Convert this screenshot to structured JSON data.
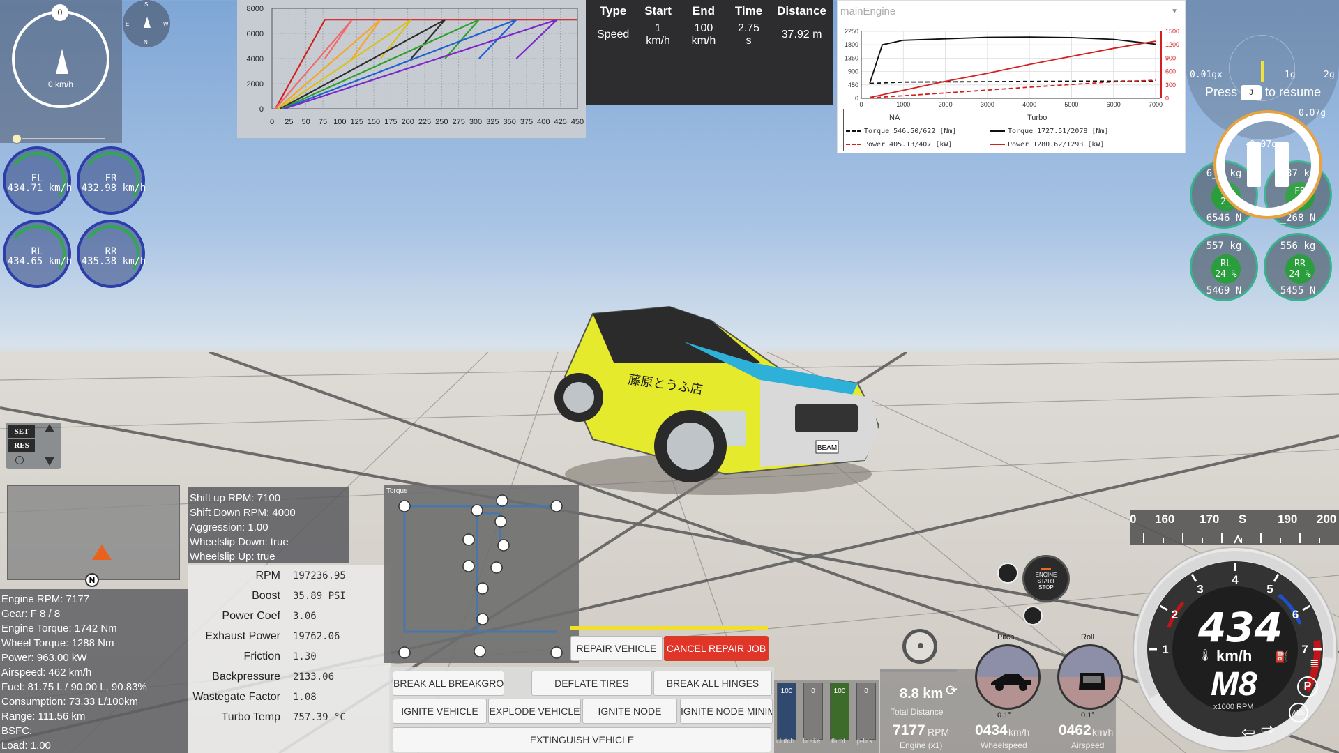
{
  "colors": {
    "accent_red": "#e1352a",
    "yellow": "#f0e02a",
    "green": "#2a9d3c",
    "blue_ring": "#2c3ea8"
  },
  "speedometer": {
    "top_value": "0",
    "speed_text": "0 km/h"
  },
  "compass_mini": {
    "n": "N",
    "s": "S",
    "e": "E",
    "w": "W"
  },
  "wheel_speeds": [
    {
      "label": "FL",
      "value": "434.71 km/h"
    },
    {
      "label": "FR",
      "value": "432.98 km/h"
    },
    {
      "label": "RL",
      "value": "434.65 km/h"
    },
    {
      "label": "RR",
      "value": "435.38 km/h"
    }
  ],
  "chart_data": [
    {
      "type": "line",
      "title": "",
      "xlabel": "",
      "ylabel": "",
      "xlim": [
        0,
        450
      ],
      "ylim": [
        0,
        8000
      ],
      "x_ticks": [
        "0",
        "25",
        "50",
        "75",
        "100",
        "125",
        "150",
        "175",
        "200",
        "225",
        "250",
        "275",
        "300",
        "325",
        "350",
        "375",
        "400",
        "425",
        "450"
      ],
      "y_ticks": [
        "0",
        "2000",
        "4000",
        "6000",
        "8000"
      ],
      "series": [
        {
          "color": "#d41f1f",
          "x": [
            5,
            78,
            78,
            450
          ],
          "y": [
            0,
            7100,
            7100,
            7100
          ]
        },
        {
          "color": "#f06a6a",
          "x": [
            5,
            118,
            78,
            118
          ],
          "y": [
            0,
            7100,
            4000,
            7100
          ]
        },
        {
          "color": "#f5a623",
          "x": [
            8,
            160,
            118,
            160
          ],
          "y": [
            0,
            7100,
            4000,
            7100
          ]
        },
        {
          "color": "#d8c21c",
          "x": [
            10,
            205,
            160,
            205
          ],
          "y": [
            0,
            7100,
            4000,
            7100
          ]
        },
        {
          "color": "#2e2e2e",
          "x": [
            12,
            255,
            205,
            255
          ],
          "y": [
            0,
            7100,
            4000,
            7100
          ]
        },
        {
          "color": "#2ca02c",
          "x": [
            14,
            305,
            255,
            305
          ],
          "y": [
            0,
            7100,
            4000,
            7100
          ]
        },
        {
          "color": "#1f5fd4",
          "x": [
            16,
            360,
            305,
            360
          ],
          "y": [
            0,
            7100,
            4000,
            7100
          ]
        },
        {
          "color": "#7a28c9",
          "x": [
            18,
            420,
            360,
            420
          ],
          "y": [
            0,
            7100,
            4000,
            7100
          ]
        }
      ]
    },
    {
      "type": "line",
      "title": "mainEngine",
      "xlabel": "",
      "ylabel": "",
      "xlim": [
        0,
        7100
      ],
      "ylim_left": [
        0,
        2250
      ],
      "ylim_right": [
        0,
        1500
      ],
      "x_ticks": [
        "0",
        "1000",
        "2000",
        "3000",
        "4000",
        "5000",
        "6000",
        "7000"
      ],
      "y_ticks_left": [
        "0",
        "450",
        "900",
        "1350",
        "1800",
        "2250"
      ],
      "y_ticks_right": [
        "0",
        "300",
        "600",
        "900",
        "1200",
        "1500"
      ],
      "series": [
        {
          "name": "NA Torque",
          "style": "dashed",
          "color": "#111111",
          "x": [
            200,
            1000,
            3000,
            5000,
            7000
          ],
          "y": [
            500,
            546,
            560,
            575,
            580
          ]
        },
        {
          "name": "NA Power",
          "style": "dashed",
          "color": "#d41f1f",
          "x": [
            200,
            2000,
            4000,
            6000,
            7000
          ],
          "y": [
            10,
            120,
            250,
            370,
            405
          ]
        },
        {
          "name": "Turbo Torque",
          "style": "solid",
          "color": "#111111",
          "x": [
            200,
            500,
            1000,
            2000,
            3000,
            4000,
            5000,
            6000,
            7000
          ],
          "y": [
            500,
            1800,
            1950,
            2000,
            2050,
            2060,
            2040,
            1980,
            1820
          ]
        },
        {
          "name": "Turbo Power",
          "style": "solid",
          "color": "#d41f1f",
          "x": [
            200,
            1000,
            2000,
            3000,
            4000,
            5000,
            6000,
            7000
          ],
          "y": [
            20,
            180,
            380,
            560,
            760,
            940,
            1120,
            1280
          ]
        }
      ]
    }
  ],
  "engine_chart": {
    "dropdown": "mainEngine",
    "na_header": "NA",
    "turbo_header": "Turbo",
    "na_torque": "Torque 546.50/622 [Nm]",
    "na_power": "Power 405.13/407 [kW]",
    "turbo_torque": "Torque 1727.51/2078 [Nm]",
    "turbo_power": "Power 1280.62/1293 [kW]"
  },
  "timing_table": {
    "headers": [
      "Type",
      "Start",
      "End",
      "Time",
      "Distance"
    ],
    "row": [
      "Speed",
      "1 km/h",
      "100 km/h",
      "2.75 s",
      "37.92 m"
    ]
  },
  "gforce": {
    "left": "0.01gx",
    "g1": "1g",
    "g2": "2g",
    "right": "0.07g",
    "lower": "-0.07gy"
  },
  "resume": {
    "press": "Press",
    "key": "J",
    "suffix": "to resume"
  },
  "tire_loads": [
    {
      "kg": "6__ kg",
      "label": "FL",
      "pct": "2_",
      "n": "6546 N"
    },
    {
      "kg": "537 kg",
      "label": "FR",
      "pct": "2_",
      "n": "_268 N"
    },
    {
      "kg": "557 kg",
      "label": "RL",
      "pct": "24 %",
      "n": "5469 N"
    },
    {
      "kg": "556 kg",
      "label": "RR",
      "pct": "24 %",
      "n": "5455 N"
    }
  ],
  "cruise": {
    "set": "SET",
    "res": "RES"
  },
  "minimap": {
    "north": "N"
  },
  "shift_info": [
    "Shift up RPM: 7100",
    "Shift Down RPM: 4000",
    "Aggression: 1.00",
    "Wheelslip Down: true",
    "Wheelslip Up: true"
  ],
  "vehicle_info": [
    "Engine RPM: 7177",
    "Gear: F 8 / 8",
    "Engine Torque: 1742 Nm",
    "Wheel Torque: 1288 Nm",
    "Power: 963.00 kW",
    "Airspeed: 462 km/h",
    "Fuel: 81.75 L / 90.00 L, 90.83%",
    "Consumption: 73.33 L/100km",
    "Range: 111.56 km",
    "BSFC:",
    "Load: 1.00"
  ],
  "engine_debug": [
    {
      "k": "RPM",
      "v": "197236.95"
    },
    {
      "k": "Boost",
      "v": "35.89 PSI"
    },
    {
      "k": "Power Coef",
      "v": "3.06"
    },
    {
      "k": "Exhaust Power",
      "v": "19762.06"
    },
    {
      "k": "Friction",
      "v": "1.30"
    },
    {
      "k": "Backpressure",
      "v": "2133.06"
    },
    {
      "k": "Wastegate Factor",
      "v": "1.08"
    },
    {
      "k": "Turbo Temp",
      "v": "757.39 °C"
    }
  ],
  "powertrain": {
    "title": "Torque"
  },
  "buttons": {
    "repair": "REPAIR VEHICLE",
    "cancel_repair": "CANCEL REPAIR JOB",
    "break_groups": "BREAK ALL BREAKGROUPS",
    "deflate": "DEFLATE TIRES",
    "break_hinges": "BREAK ALL HINGES",
    "ignite_vehicle": "IGNITE VEHICLE",
    "explode": "EXPLODE VEHICLE",
    "ignite_node": "IGNITE NODE",
    "ignite_node_min": "IGNITE NODE MINIMAL",
    "extinguish": "EXTINGUISH VEHICLE"
  },
  "pedals": [
    {
      "label": "clutch",
      "value": "100",
      "level": 1.0,
      "color": "#2f4a6e"
    },
    {
      "label": "brake",
      "value": "0",
      "level": 0.0,
      "color": "#777777"
    },
    {
      "label": "throt",
      "value": "100",
      "level": 1.0,
      "color": "#3d6b2a"
    },
    {
      "label": "p-brk",
      "value": "0",
      "level": 0.0,
      "color": "#777777"
    }
  ],
  "stats": {
    "distance": "8.8 km",
    "distance_label": "Total Distance",
    "rpm": "7177",
    "rpm_unit": "RPM",
    "rpm_label": "Engine (x1)",
    "wheelspeed": "0434",
    "wheelspeed_unit": "km/h",
    "wheelspeed_label": "Wheelspeed",
    "airspeed": "0462",
    "airspeed_unit": "km/h",
    "airspeed_label": "Airspeed"
  },
  "attitude": {
    "pitch_label": "Pitch",
    "roll_label": "Roll",
    "pitch_val": "0.1°",
    "roll_val": "0.1°"
  },
  "engine_button": {
    "line1": "ENGINE",
    "line2": "START",
    "line3": "STOP"
  },
  "heading_strip": [
    "0",
    "160",
    "170",
    "S",
    "190",
    "200"
  ],
  "main_gauge": {
    "speed": "434",
    "unit": "km/h",
    "gear": "M8",
    "rpm_unit": "x1000 RPM",
    "ticks": [
      "1",
      "2",
      "3",
      "4",
      "5",
      "6",
      "7"
    ],
    "rpm_level": 7.177,
    "rpm_max": 8
  },
  "car": {
    "plate": "BEAM",
    "decal": "藤原とうふ店"
  }
}
